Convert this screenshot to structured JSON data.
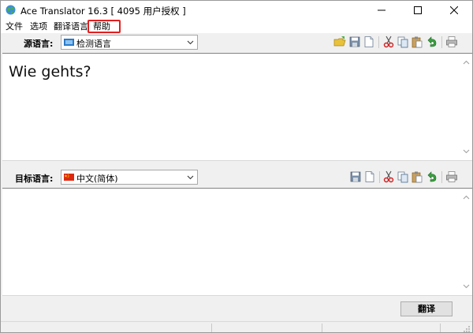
{
  "window": {
    "title": "Ace Translator 16.3  [ 4095 用户授权 ]"
  },
  "menu": {
    "items": [
      {
        "label": "文件"
      },
      {
        "label": "选项"
      },
      {
        "label": "翻译语言"
      },
      {
        "label": "帮助"
      }
    ],
    "highlighted": "帮助",
    "highlight_color": "#e02020"
  },
  "source": {
    "label": "源语言:",
    "language": "检测语言",
    "text": "Wie gehts?"
  },
  "target": {
    "label": "目标语言:",
    "language": "中文(简体)",
    "text": ""
  },
  "toolbar_icons": {
    "source": [
      "open-folder-icon",
      "save-icon",
      "new-doc-icon",
      "cut-icon",
      "copy-icon",
      "paste-icon",
      "undo-icon",
      "print-icon"
    ],
    "target": [
      "save-icon",
      "new-doc-icon",
      "cut-icon",
      "copy-icon",
      "paste-icon",
      "undo-icon",
      "print-icon"
    ]
  },
  "actions": {
    "translate_label": "翻译"
  }
}
